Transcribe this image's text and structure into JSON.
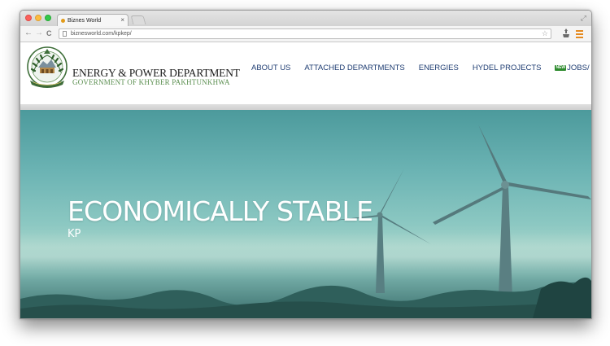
{
  "browser": {
    "tab_title": "Biznes World",
    "tab_close": "×",
    "url": "biznesworld.com/kpkep/",
    "back": "←",
    "forward": "→",
    "reload": "C",
    "star": "☆",
    "resize": "⤢"
  },
  "header": {
    "department_title": "ENERGY & POWER DEPARTMENT",
    "government_title": "GOVERNMENT OF KHYBER PAKHTUNKHWA",
    "nav": [
      {
        "label": "ABOUT US"
      },
      {
        "label": "ATTACHED DEPARTMENTS"
      },
      {
        "label": "ENERGIES"
      },
      {
        "label": "HYDEL PROJECTS"
      },
      {
        "label": "JOBS/ TENDERS",
        "badge": "NEW"
      }
    ]
  },
  "hero": {
    "title": "ECONOMICALLY STABLE",
    "subtitle": "KP"
  },
  "colors": {
    "nav_text": "#1e3c72",
    "gov_green": "#5a8e4f",
    "hero_teal": "#6cb4b4"
  }
}
